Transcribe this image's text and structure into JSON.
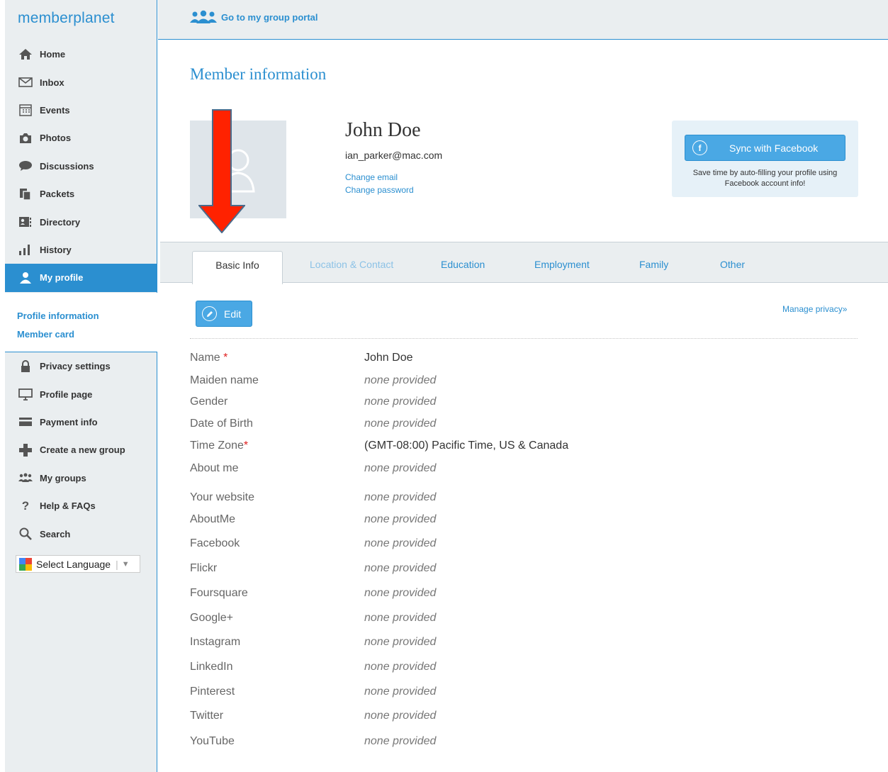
{
  "app": {
    "logo": "memberplanet"
  },
  "topbar": {
    "portal_label": "Go to my group portal"
  },
  "sidebar": {
    "nav": [
      {
        "label": "Home",
        "icon": "home-icon"
      },
      {
        "label": "Inbox",
        "icon": "envelope-icon"
      },
      {
        "label": "Events",
        "icon": "calendar-icon"
      },
      {
        "label": "Photos",
        "icon": "camera-icon"
      },
      {
        "label": "Discussions",
        "icon": "speech-bubble-icon"
      },
      {
        "label": "Packets",
        "icon": "packets-icon"
      },
      {
        "label": "Directory",
        "icon": "address-card-icon"
      },
      {
        "label": "History",
        "icon": "bar-chart-icon"
      },
      {
        "label": "My profile",
        "icon": "user-icon",
        "active": true
      }
    ],
    "subnav": [
      "Profile information",
      "Member card"
    ],
    "nav2": [
      {
        "label": "Privacy settings",
        "icon": "lock-icon"
      },
      {
        "label": "Profile page",
        "icon": "monitor-icon"
      },
      {
        "label": "Payment info",
        "icon": "credit-card-icon"
      },
      {
        "label": "Create a new group",
        "icon": "plus-icon"
      },
      {
        "label": "My groups",
        "icon": "group-icon"
      },
      {
        "label": "Help & FAQs",
        "icon": "question-icon"
      },
      {
        "label": "Search",
        "icon": "search-icon"
      }
    ],
    "language_select": "Select Language"
  },
  "main": {
    "page_title": "Member information",
    "member": {
      "name": "John Doe",
      "email": "ian_parker@mac.com",
      "change_email": "Change email",
      "change_password": "Change password"
    },
    "facebook": {
      "button_label": "Sync with Facebook",
      "note_line1": "Save time by auto-filling your profile using",
      "note_line2": "Facebook account info!"
    },
    "tabs": [
      {
        "label": "Basic Info",
        "active": true
      },
      {
        "label": "Location & Contact",
        "muted": true
      },
      {
        "label": "Education"
      },
      {
        "label": "Employment"
      },
      {
        "label": "Family"
      },
      {
        "label": "Other"
      }
    ],
    "edit_label": "Edit",
    "manage_privacy": "Manage privacy»",
    "required_mark": "*",
    "fields": [
      {
        "label": "Name",
        "required": true,
        "value": "John Doe",
        "empty": false
      },
      {
        "label": "Maiden name",
        "value": "none provided",
        "empty": true
      },
      {
        "label": "Gender",
        "value": "none provided",
        "empty": true
      },
      {
        "label": "Date of Birth",
        "value": "none provided",
        "empty": true
      },
      {
        "label": "Time Zone",
        "required": true,
        "value": "(GMT-08:00) Pacific Time, US & Canada",
        "empty": false
      },
      {
        "label": "About me",
        "value": "none provided",
        "empty": true
      },
      {
        "label": "Your website",
        "value": "none provided",
        "empty": true
      },
      {
        "label": "AboutMe",
        "value": "none provided",
        "empty": true
      },
      {
        "label": "Facebook",
        "value": "none provided",
        "empty": true
      },
      {
        "label": "Flickr",
        "value": "none provided",
        "empty": true
      },
      {
        "label": "Foursquare",
        "value": "none provided",
        "empty": true
      },
      {
        "label": "Google+",
        "value": "none provided",
        "empty": true
      },
      {
        "label": "Instagram",
        "value": "none provided",
        "empty": true
      },
      {
        "label": "LinkedIn",
        "value": "none provided",
        "empty": true
      },
      {
        "label": "Pinterest",
        "value": "none provided",
        "empty": true
      },
      {
        "label": "Twitter",
        "value": "none provided",
        "empty": true
      },
      {
        "label": "YouTube",
        "value": "none provided",
        "empty": true
      }
    ]
  },
  "colors": {
    "accent": "#2b8fd0",
    "sidebar_bg": "#eaeef0",
    "required": "#e02020",
    "annotation_arrow": "#ff2200"
  }
}
